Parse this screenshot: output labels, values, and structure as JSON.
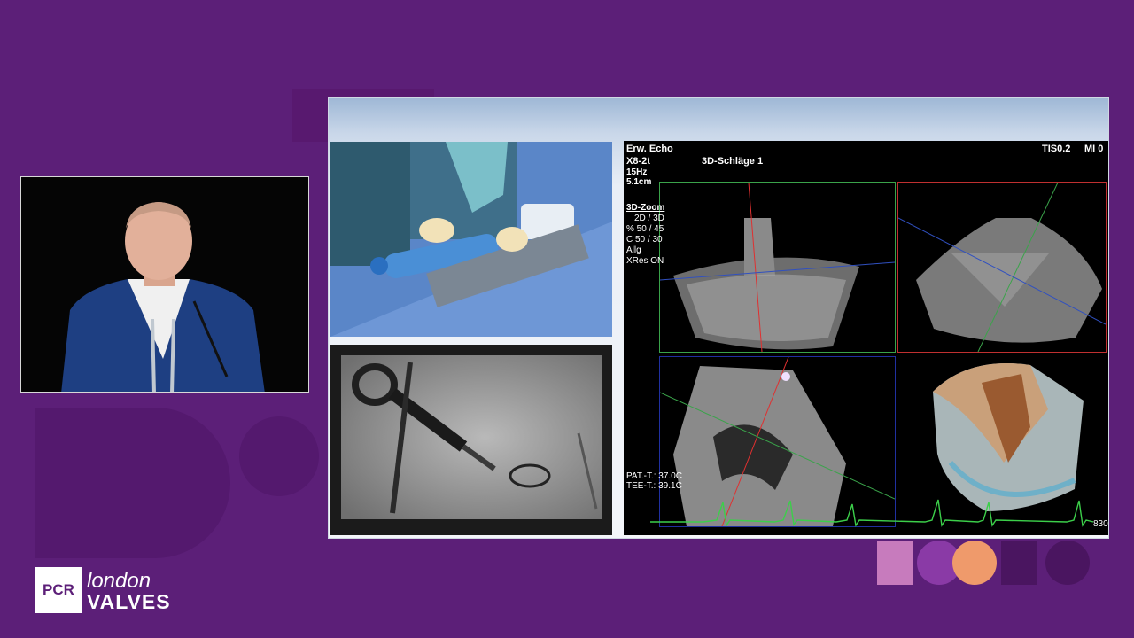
{
  "brand": {
    "logo_box_text": "PCR",
    "logo_line1": "london",
    "logo_line2": "VALVES",
    "colors": {
      "background": "#5c1f78",
      "accent_orange": "#ef9a6b",
      "accent_pink": "#c77bbd"
    }
  },
  "speaker_feed": {
    "icon": "presenter-video"
  },
  "slide": {
    "top_left_panel": {
      "icon": "procedure-photo"
    },
    "bottom_left_panel": {
      "icon": "fluoroscopy-image"
    },
    "echo_panel": {
      "mode": "Erw. Echo",
      "probe": "X8-2t",
      "frame_rate": "15Hz",
      "depth": "5.1cm",
      "beats_label": "3D-Schläge 1",
      "tis": "TIS0.2",
      "mi": "MI 0",
      "zoom_title": "3D-Zoom",
      "zoom_lines": [
        "2D / 3D",
        "% 50 / 45",
        "C  50 / 30",
        "Allg",
        "XRes ON"
      ],
      "pat_temp": "PAT.-T.: 37.0C",
      "tee_temp": "TEE-T.: 39.1C",
      "frame_counter": "830"
    }
  }
}
